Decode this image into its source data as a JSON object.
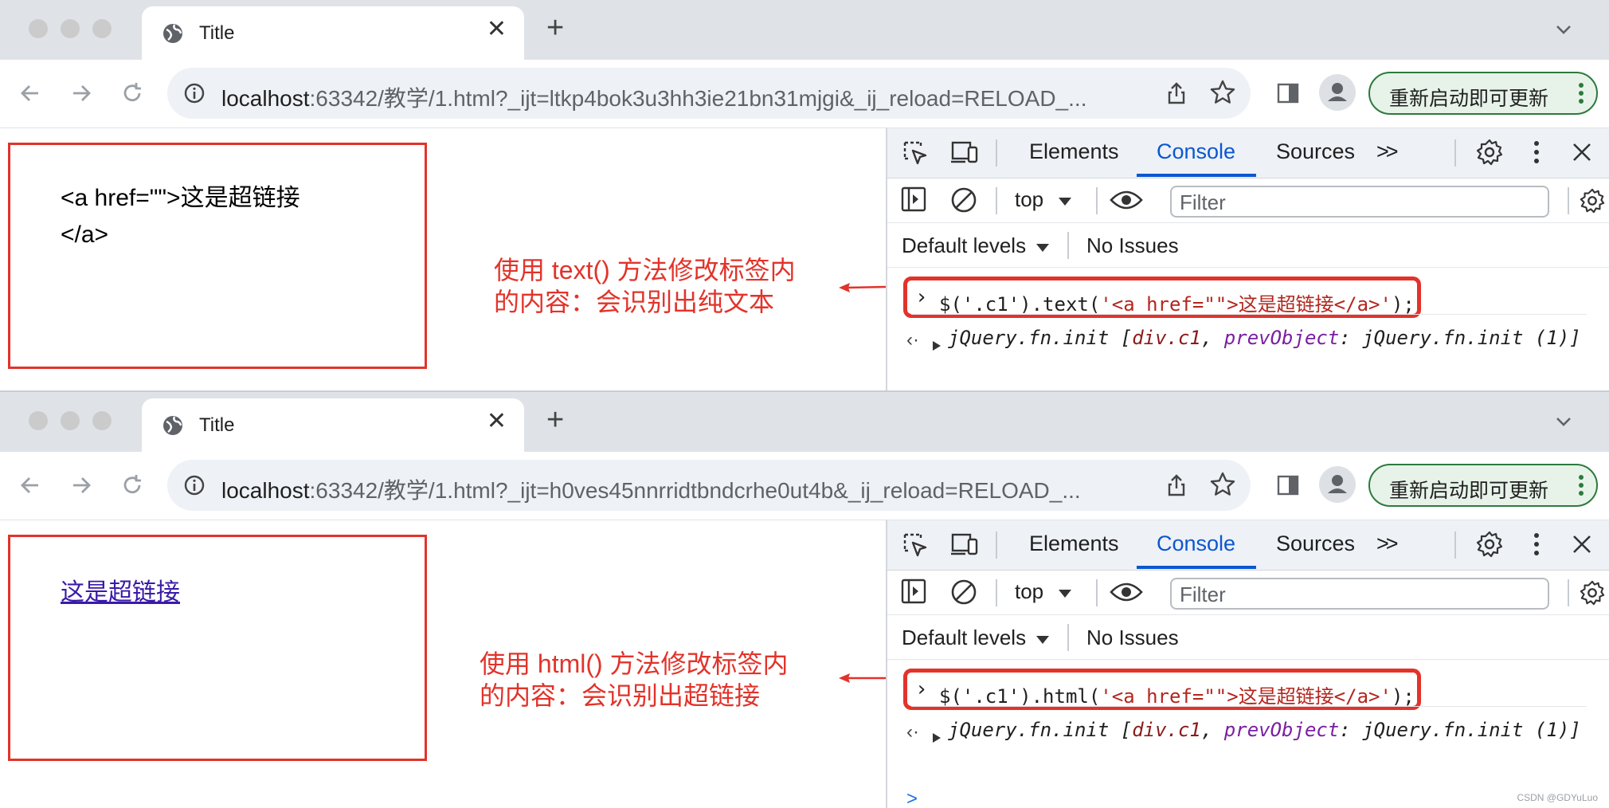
{
  "windows": [
    {
      "tab_title": "Title",
      "url_host": "localhost",
      "url_rest": ":63342/教学/1.html?_ijt=ltkp4bok3u3hh3ie21bn31mjgi&_ij_reload=RELOAD_...",
      "update_label": "重新启动即可更新",
      "demo_text_line1": "<a href=\"\">这是超链接",
      "demo_text_line2": "</a>",
      "note_line1": "使用 text() 方法修改标签内",
      "note_line2": "的内容：会识别出纯文本",
      "devtools": {
        "tabs": [
          "Elements",
          "Console",
          "Sources"
        ],
        "more_tabs": ">>",
        "context": "top",
        "filter_placeholder": "Filter",
        "levels": "Default levels",
        "issues": "No Issues",
        "cmd_prefix": "$('.c1').text(",
        "cmd_string": "'<a href=\"\">这是超链接</a>'",
        "cmd_suffix": ");",
        "result_a": "jQuery.fn.init [",
        "result_cls": "div.c1",
        "result_b": ", ",
        "result_prop": "prevObject",
        "result_c": ": jQuery.fn.init (1)]"
      }
    },
    {
      "tab_title": "Title",
      "url_host": "localhost",
      "url_rest": ":63342/教学/1.html?_ijt=h0ves45nnrridtbndcrhe0ut4b&_ij_reload=RELOAD_...",
      "update_label": "重新启动即可更新",
      "demo_link": "这是超链接",
      "note_line1": "使用 html() 方法修改标签内",
      "note_line2": "的内容：会识别出超链接",
      "devtools": {
        "tabs": [
          "Elements",
          "Console",
          "Sources"
        ],
        "more_tabs": ">>",
        "context": "top",
        "filter_placeholder": "Filter",
        "levels": "Default levels",
        "issues": "No Issues",
        "cmd_prefix": "$('.c1').html(",
        "cmd_string": "'<a href=\"\">这是超链接</a>'",
        "cmd_suffix": ");",
        "result_a": "jQuery.fn.init [",
        "result_cls": "div.c1",
        "result_b": ", ",
        "result_prop": "prevObject",
        "result_c": ": jQuery.fn.init (1)]",
        "next_prompt": ">"
      }
    }
  ],
  "credit": "CSDN @GDYuLuo",
  "colors": {
    "accent": "#0b57d0",
    "annotation": "#e2332a",
    "update_border": "#2c7a3d"
  }
}
